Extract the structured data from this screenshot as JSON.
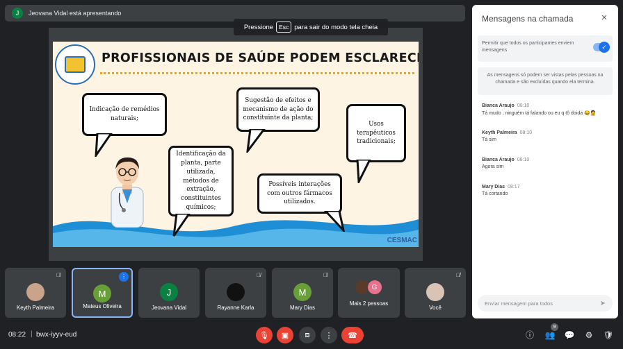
{
  "presenter": {
    "initial": "J",
    "text": "Jeovana Vidal está apresentando"
  },
  "esc_hint": {
    "prefix": "Pressione",
    "key": "Esc",
    "suffix": "para sair do modo tela cheia"
  },
  "slide": {
    "title": "PROFISSIONAIS DE SAÚDE PODEM ESCLARECER DÚVIDAS",
    "brand": "CESMAC",
    "bubbles": [
      "Indicação de remédios naturais;",
      "Identificação da planta, parte utilizada, métodos de extração, constituintes químicos;",
      "Sugestão de efeitos e mecanismo de ação do constituinte da planta;",
      "Possíveis interações com outros fármacos utilizados.",
      "Usos terapêuticos tradicionais;"
    ]
  },
  "panel": {
    "title": "Mensagens na chamada",
    "close_icon": "×",
    "permit_text": "Permitir que todos os participantes enviem mensagens",
    "toggle_on": true,
    "notice": "As mensagens só podem ser vistas pelas pessoas na chamada e são excluídas quando ela termina.",
    "messages": [
      {
        "author": "Bianca Araujo",
        "time": "08:10",
        "text": "Tá mudo , ninguém tá falando ou eu q tô doida 😂🤦"
      },
      {
        "author": "Keyth Palmeira",
        "time": "08:10",
        "text": "Tá sim"
      },
      {
        "author": "Bianca Araujo",
        "time": "08:10",
        "text": "Agora sim"
      },
      {
        "author": "Mary Dias",
        "time": "08:17",
        "text": "Tá cortando"
      }
    ],
    "input_placeholder": "Enviar mensagem para todos"
  },
  "tiles": [
    {
      "name": "Keyth Palmeira",
      "avatar": "",
      "color": "#c9a48a"
    },
    {
      "name": "Mateus Oliveira",
      "avatar": "M",
      "color": "#689f38"
    },
    {
      "name": "Jeovana Vidal",
      "avatar": "J",
      "color": "#0b8043"
    },
    {
      "name": "Rayanne Karla",
      "avatar": "",
      "color": "#2b2b2b"
    },
    {
      "name": "Mary Dias",
      "avatar": "M",
      "color": "#689f38"
    },
    {
      "name": "Mais 2 pessoas",
      "avatar": "G",
      "color": "#e8718d"
    },
    {
      "name": "Você",
      "avatar": "",
      "color": "#d9c3b4"
    }
  ],
  "bottom": {
    "time": "08:22",
    "separator": "|",
    "meeting_code": "bwx-iyyv-eud",
    "participant_count": "9"
  },
  "colors": {
    "end_call": "#ea4335",
    "accent": "#1a73e8"
  }
}
